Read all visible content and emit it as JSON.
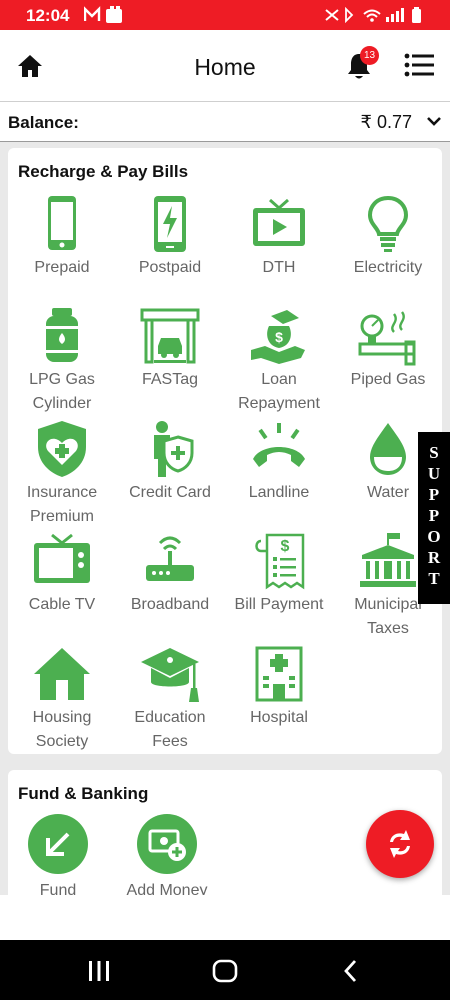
{
  "status_bar": {
    "time": "12:04"
  },
  "header": {
    "title": "Home",
    "notification_count": "13"
  },
  "balance": {
    "label": "Balance:",
    "value": "₹ 0.77"
  },
  "recharge": {
    "title": "Recharge & Pay Bills",
    "items": [
      {
        "label_1": "Prepaid",
        "label_2": "",
        "icon": "mobile-phone-icon"
      },
      {
        "label_1": "Postpaid",
        "label_2": "",
        "icon": "mobile-charge-icon"
      },
      {
        "label_1": "DTH",
        "label_2": "",
        "icon": "tv-play-icon"
      },
      {
        "label_1": "Electricity",
        "label_2": "",
        "icon": "bulb-icon"
      },
      {
        "label_1": "LPG Gas",
        "label_2": "Cylinder",
        "icon": "gas-cylinder-icon"
      },
      {
        "label_1": "FASTag",
        "label_2": "",
        "icon": "toll-booth-icon"
      },
      {
        "label_1": "Loan",
        "label_2": "Repayment",
        "icon": "loan-hand-icon"
      },
      {
        "label_1": "Piped Gas",
        "label_2": "",
        "icon": "gas-pipe-icon"
      },
      {
        "label_1": "Insurance",
        "label_2": "Premium",
        "icon": "shield-heart-icon"
      },
      {
        "label_1": "Credit Card",
        "label_2": "",
        "icon": "person-shield-icon"
      },
      {
        "label_1": "Landline",
        "label_2": "",
        "icon": "landline-phone-icon"
      },
      {
        "label_1": "Water",
        "label_2": "",
        "icon": "water-drop-icon"
      },
      {
        "label_1": "Cable TV",
        "label_2": "",
        "icon": "cable-tv-icon"
      },
      {
        "label_1": "Broadband",
        "label_2": "",
        "icon": "router-icon"
      },
      {
        "label_1": "Bill Payment",
        "label_2": "",
        "icon": "bill-receipt-icon"
      },
      {
        "label_1": "Municipal",
        "label_2": "Taxes",
        "icon": "municipal-building-icon"
      },
      {
        "label_1": "Housing",
        "label_2": "Society",
        "icon": "house-icon"
      },
      {
        "label_1": "Education",
        "label_2": "Fees",
        "icon": "graduation-cap-icon"
      },
      {
        "label_1": "Hospital",
        "label_2": "",
        "icon": "hospital-icon"
      }
    ]
  },
  "banking": {
    "title": "Fund & Banking",
    "items": [
      {
        "label": "Fund",
        "icon": "arrow-down-left-icon"
      },
      {
        "label": "Add Money",
        "icon": "add-money-icon"
      }
    ]
  },
  "support": {
    "letters": [
      "S",
      "U",
      "P",
      "P",
      "O",
      "R",
      "T"
    ]
  },
  "colors": {
    "brand_red": "#ee1c25",
    "icon_green": "#4caf50",
    "label_gray": "#666666"
  }
}
